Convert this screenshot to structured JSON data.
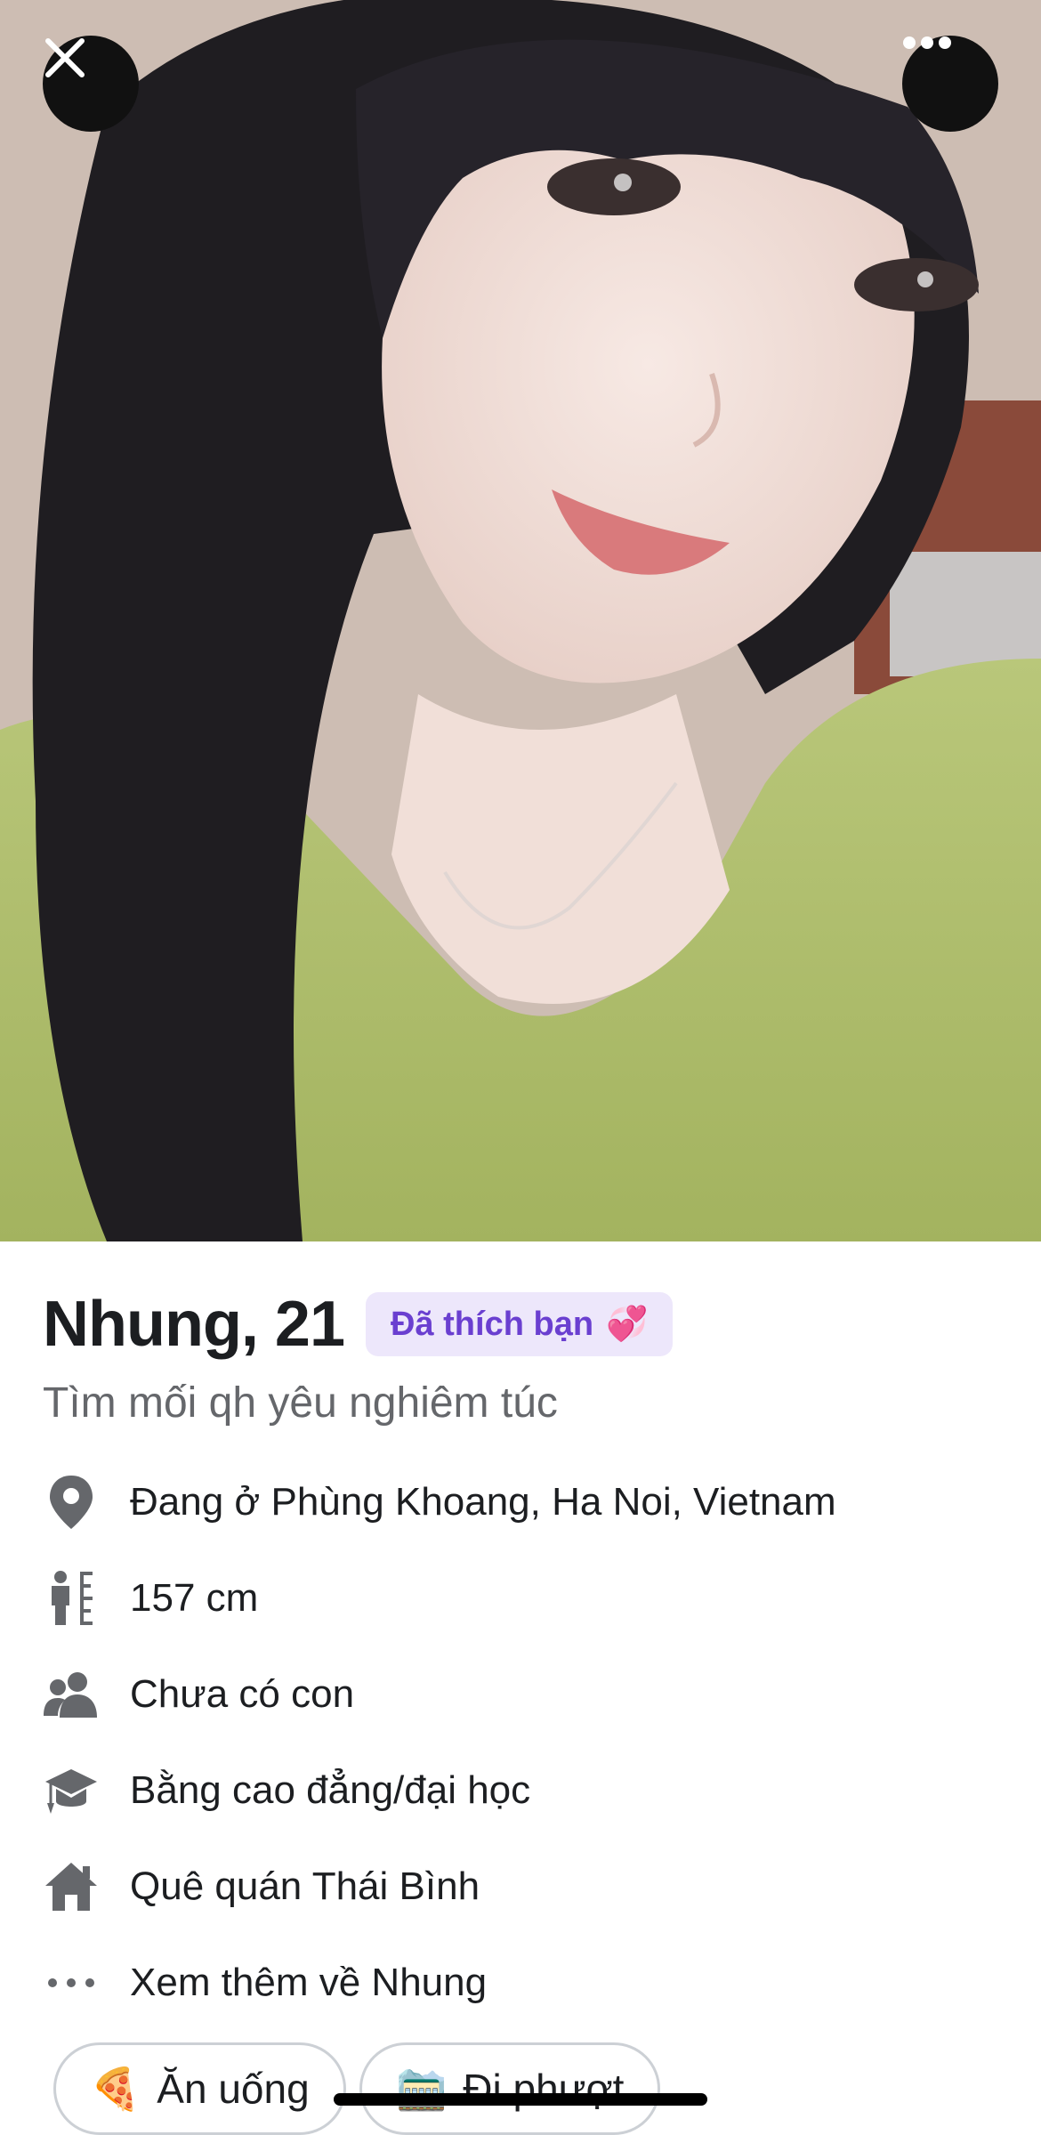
{
  "profile": {
    "name_age": "Nhung, 21",
    "liked_badge": "Đã thích bạn",
    "liked_badge_emoji": "💞",
    "tagline": "Tìm mối qh yêu nghiêm túc"
  },
  "details": [
    {
      "icon": "location-pin-icon",
      "text": "Đang ở Phùng Khoang, Ha Noi, Vietnam"
    },
    {
      "icon": "height-icon",
      "text": "157 cm"
    },
    {
      "icon": "people-icon",
      "text": "Chưa có con"
    },
    {
      "icon": "graduation-cap-icon",
      "text": "Bằng cao đẳng/đại học"
    },
    {
      "icon": "house-icon",
      "text": "Quê quán Thái Bình"
    },
    {
      "icon": "more-dots-icon",
      "text": "Xem thêm về Nhung"
    }
  ],
  "interests": [
    {
      "emoji": "🍕",
      "label": "Ăn uống"
    },
    {
      "emoji": "🚞",
      "label": "Đi phượt"
    }
  ],
  "colors": {
    "badge_bg": "#ede7fb",
    "badge_text": "#6a3fd0",
    "icon_gray": "#65676b"
  }
}
